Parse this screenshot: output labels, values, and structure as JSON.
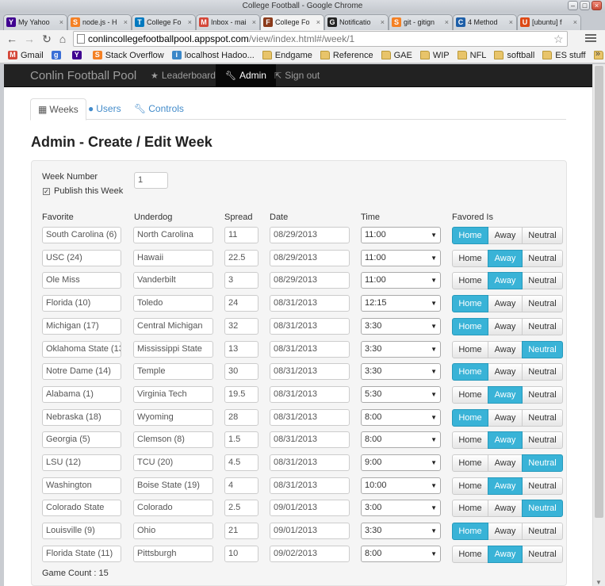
{
  "window": {
    "title": "College Football - Google Chrome"
  },
  "tabs": [
    {
      "label": "My Yahoo",
      "icon": "Y",
      "color": "#400090"
    },
    {
      "label": "node.js - H",
      "icon": "S",
      "color": "#f48024"
    },
    {
      "label": "College Fo",
      "icon": "T",
      "color": "#0079bf"
    },
    {
      "label": "Inbox - mai",
      "icon": "M",
      "color": "#d44638"
    },
    {
      "label": "College Fo",
      "icon": "F",
      "color": "#8b3a1a",
      "active": true
    },
    {
      "label": "Notificatio",
      "icon": "G",
      "color": "#222222"
    },
    {
      "label": "git - gitign",
      "icon": "S",
      "color": "#f48024"
    },
    {
      "label": "4 Method",
      "icon": "C",
      "color": "#1e5fa8"
    },
    {
      "label": "[ubuntu] f",
      "icon": "U",
      "color": "#dd4814"
    }
  ],
  "address": {
    "host": "conlincollegefootballpool.appspot.com",
    "path": "/view/index.html#/week/1"
  },
  "bookmarks": [
    {
      "label": "Gmail",
      "icon": "M",
      "color": "#d44638"
    },
    {
      "label": "",
      "icon": "g",
      "color": "#3b6fd6"
    },
    {
      "label": "",
      "icon": "Y",
      "color": "#400090"
    },
    {
      "label": "Stack Overflow",
      "icon": "S",
      "color": "#f48024"
    },
    {
      "label": "localhost Hadoo...",
      "icon": "i",
      "color": "#3a87c8"
    },
    {
      "label": "Endgame",
      "icon": "folder"
    },
    {
      "label": "Reference",
      "icon": "folder"
    },
    {
      "label": "GAE",
      "icon": "folder"
    },
    {
      "label": "WIP",
      "icon": "folder"
    },
    {
      "label": "NFL",
      "icon": "folder"
    },
    {
      "label": "softball",
      "icon": "folder"
    },
    {
      "label": "ES stuff",
      "icon": "folder"
    },
    {
      "label": "AWS",
      "icon": "folder"
    }
  ],
  "navbar": {
    "brand": "Conlin Football Pool",
    "items": [
      {
        "label": "Leaderboard",
        "icon": "star-icon"
      },
      {
        "label": "Admin",
        "icon": "wrench-icon",
        "active": true
      },
      {
        "label": "Sign out",
        "icon": "sign-out-icon"
      }
    ]
  },
  "subtabs": [
    {
      "label": "Weeks",
      "icon": "calendar-icon",
      "active": true
    },
    {
      "label": "Users",
      "icon": "user-icon"
    },
    {
      "label": "Controls",
      "icon": "wrench-icon"
    }
  ],
  "page_title": "Admin - Create / Edit Week",
  "form": {
    "week_number_label": "Week Number",
    "week_number": "1",
    "publish_label": "Publish this Week",
    "published": true,
    "columns": [
      "Favorite",
      "Underdog",
      "Spread",
      "Date",
      "Time",
      "Favored Is"
    ],
    "favored_options": [
      "Home",
      "Away",
      "Neutral"
    ],
    "games": [
      {
        "favorite": "South Carolina (6)",
        "underdog": "North Carolina",
        "spread": "11",
        "date": "08/29/2013",
        "time": "11:00",
        "favored": "Home"
      },
      {
        "favorite": "USC (24)",
        "underdog": "Hawaii",
        "spread": "22.5",
        "date": "08/29/2013",
        "time": "11:00",
        "favored": "Away"
      },
      {
        "favorite": "Ole Miss",
        "underdog": "Vanderbilt",
        "spread": "3",
        "date": "08/29/2013",
        "time": "11:00",
        "favored": "Away"
      },
      {
        "favorite": "Florida (10)",
        "underdog": "Toledo",
        "spread": "24",
        "date": "08/31/2013",
        "time": "12:15",
        "favored": "Home"
      },
      {
        "favorite": "Michigan (17)",
        "underdog": "Central Michigan",
        "spread": "32",
        "date": "08/31/2013",
        "time": "3:30",
        "favored": "Home"
      },
      {
        "favorite": "Oklahoma State (13",
        "underdog": "Mississippi State",
        "spread": "13",
        "date": "08/31/2013",
        "time": "3:30",
        "favored": "Neutral"
      },
      {
        "favorite": "Notre Dame (14)",
        "underdog": "Temple",
        "spread": "30",
        "date": "08/31/2013",
        "time": "3:30",
        "favored": "Home"
      },
      {
        "favorite": "Alabama (1)",
        "underdog": "Virginia Tech",
        "spread": "19.5",
        "date": "08/31/2013",
        "time": "5:30",
        "favored": "Away"
      },
      {
        "favorite": "Nebraska (18)",
        "underdog": "Wyoming",
        "spread": "28",
        "date": "08/31/2013",
        "time": "8:00",
        "favored": "Home"
      },
      {
        "favorite": "Georgia (5)",
        "underdog": "Clemson (8)",
        "spread": "1.5",
        "date": "08/31/2013",
        "time": "8:00",
        "favored": "Away"
      },
      {
        "favorite": "LSU (12)",
        "underdog": "TCU (20)",
        "spread": "4.5",
        "date": "08/31/2013",
        "time": "9:00",
        "favored": "Neutral"
      },
      {
        "favorite": "Washington",
        "underdog": "Boise State (19)",
        "spread": "4",
        "date": "08/31/2013",
        "time": "10:00",
        "favored": "Away"
      },
      {
        "favorite": "Colorado State",
        "underdog": "Colorado",
        "spread": "2.5",
        "date": "09/01/2013",
        "time": "3:00",
        "favored": "Neutral"
      },
      {
        "favorite": "Louisville (9)",
        "underdog": "Ohio",
        "spread": "21",
        "date": "09/01/2013",
        "time": "3:30",
        "favored": "Home"
      },
      {
        "favorite": "Florida State (11)",
        "underdog": "Pittsburgh",
        "spread": "10",
        "date": "09/02/2013",
        "time": "8:00",
        "favored": "Away"
      }
    ],
    "game_count_label": "Game Count : 15"
  }
}
